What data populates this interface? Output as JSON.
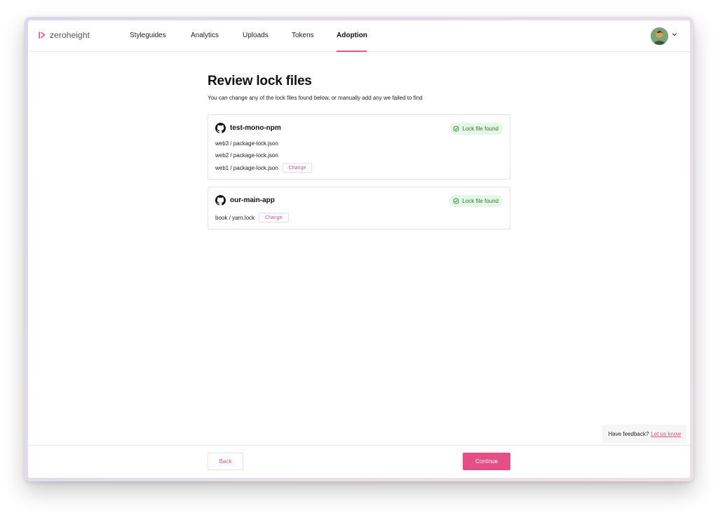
{
  "app": {
    "logo_text": "zeroheight",
    "brand_color": "#e54f85"
  },
  "nav": {
    "items": [
      {
        "label": "Styleguides",
        "active": false
      },
      {
        "label": "Analytics",
        "active": false
      },
      {
        "label": "Uploads",
        "active": false
      },
      {
        "label": "Tokens",
        "active": false
      },
      {
        "label": "Adoption",
        "active": true
      }
    ]
  },
  "page": {
    "title": "Review lock files",
    "subtitle": "You can change any of the lock files found below, or manually add any we failed to find"
  },
  "repos": [
    {
      "name": "test-mono-npm",
      "status": "Lock file found",
      "lock_files": [
        {
          "path": "web3 / package-lock.json"
        },
        {
          "path": "web2 / package-lock.json"
        },
        {
          "path": "web1 / package-lock.json",
          "change_label": "Change"
        }
      ]
    },
    {
      "name": "our-main-app",
      "status": "Lock file found",
      "lock_files": [
        {
          "path": "book / yarn.lock",
          "change_label": "Change"
        }
      ]
    }
  ],
  "feedback": {
    "prompt": "Have feedback?",
    "link": "Let us know"
  },
  "footer": {
    "back_label": "Back",
    "continue_label": "Continue"
  },
  "icons": {
    "logo": "zeroheight-logo-icon",
    "repo": "github-icon",
    "status": "check-circle-icon",
    "account_menu": "chevron-down-icon"
  },
  "colors": {
    "accent": "#e54f85",
    "success_bg": "#e6f6e7",
    "success_text": "#2c7a37"
  }
}
